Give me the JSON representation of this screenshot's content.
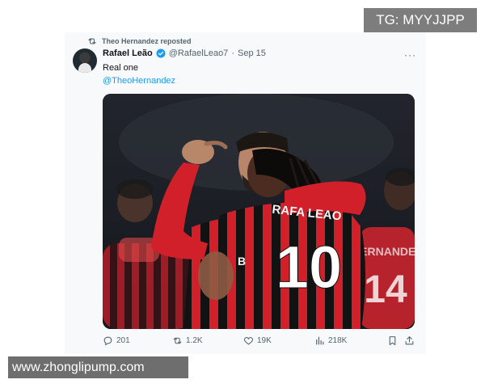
{
  "repost": {
    "icon": "repost-icon",
    "text": "Theo Hernandez reposted"
  },
  "tweet": {
    "display_name": "Rafael Leão",
    "verified_icon": "verified-badge-icon",
    "handle": "@RafaelLeao7",
    "separator": "·",
    "date": "Sep 15",
    "more_label": "···",
    "text": "Real one",
    "mention": "@TheoHernandez",
    "media": {
      "jersey_name": "RAFA LEAO",
      "jersey_number": "10",
      "bg_name": "HERNANDEZ",
      "bg_number": "14",
      "jersey_letter": "B"
    }
  },
  "actions": {
    "replies": "201",
    "reposts": "1.2K",
    "likes": "19K",
    "views": "218K",
    "icons": [
      "reply-icon",
      "repost-icon",
      "like-icon",
      "views-icon",
      "bookmark-icon",
      "share-icon"
    ]
  },
  "watermarks": {
    "top": "TG: MYYJJPP",
    "bottom": "www.zhonglipump.com"
  },
  "colors": {
    "link": "#1d9bf0",
    "muted": "#536471",
    "milan_red": "#d1202a",
    "milan_black": "#121212"
  }
}
